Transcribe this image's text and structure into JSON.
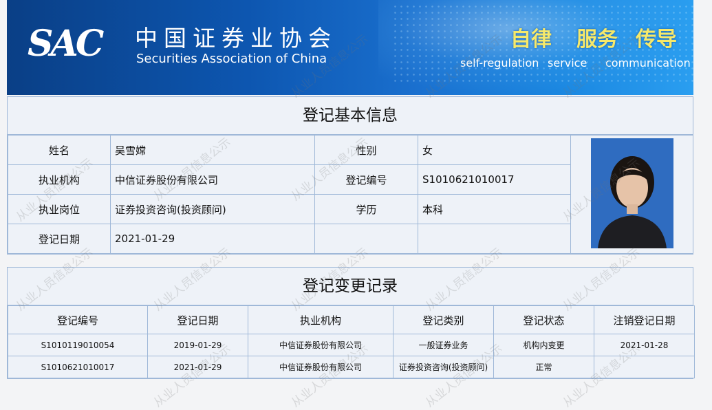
{
  "header": {
    "logo_text": "SAC",
    "org_name_cn": "中国证券业协会",
    "org_name_en": "Securities Association of China",
    "slogans": [
      {
        "cn": "自律",
        "en": "self-regulation"
      },
      {
        "cn": "服务",
        "en": "service"
      },
      {
        "cn": "传导",
        "en": "communication"
      }
    ]
  },
  "basic_info": {
    "title": "登记基本信息",
    "name_label": "姓名",
    "name": "吴雪嫦",
    "gender_label": "性别",
    "gender": "女",
    "org_label": "执业机构",
    "org": "中信证券股份有限公司",
    "reg_no_label": "登记编号",
    "reg_no": "S1010621010017",
    "position_label": "执业岗位",
    "position": "证券投资咨询(投资顾问)",
    "education_label": "学历",
    "education": "本科",
    "reg_date_label": "登记日期",
    "reg_date": "2021-01-29"
  },
  "change_records": {
    "title": "登记变更记录",
    "headers": [
      "登记编号",
      "登记日期",
      "执业机构",
      "登记类别",
      "登记状态",
      "注销登记日期"
    ],
    "rows": [
      [
        "S1010119010054",
        "2019-01-29",
        "中信证券股份有限公司",
        "一般证券业务",
        "机构内变更",
        "2021-01-28"
      ],
      [
        "S1010621010017",
        "2021-01-29",
        "中信证券股份有限公司",
        "证券投资咨询(投资顾问)",
        "正常",
        ""
      ]
    ]
  },
  "watermark_text": "从业人员信息公示",
  "colors": {
    "banner_dark": "#0a3f86",
    "banner_light": "#2a9ef0",
    "slogan_yellow": "#f6e96a",
    "table_border": "#9fb8d8",
    "cell_bg": "#eef2f8"
  }
}
